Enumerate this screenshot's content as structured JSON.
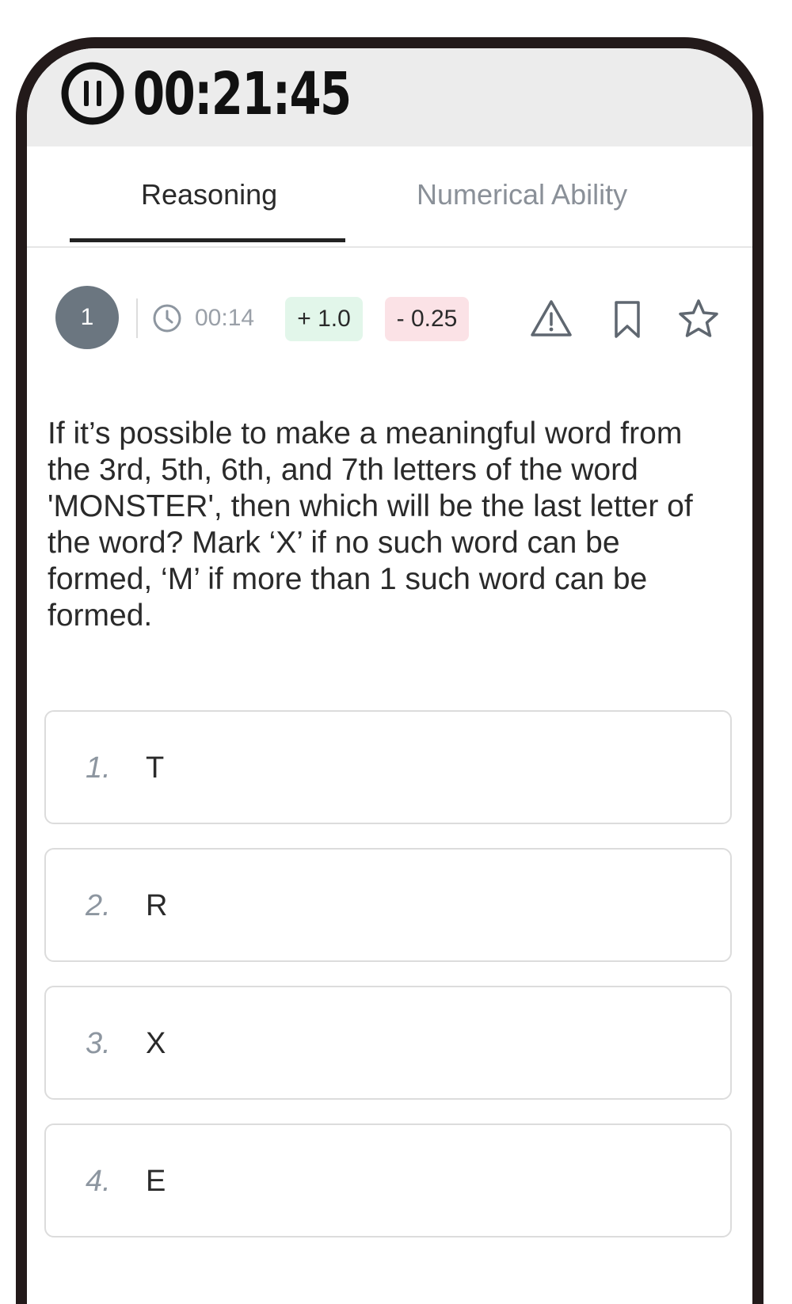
{
  "timer": {
    "value": "00:21:45",
    "icon": "pause-icon"
  },
  "tabs": [
    {
      "label": "Reasoning",
      "active": true
    },
    {
      "label": "Numerical Ability",
      "active": false
    }
  ],
  "question_bar": {
    "number": "1",
    "time": "00:14",
    "positive_marks": "+ 1.0",
    "negative_marks": "- 0.25",
    "icons": [
      "clock-icon",
      "warning-icon",
      "bookmark-icon",
      "star-icon"
    ]
  },
  "question": {
    "text": "If it’s possible to make a meaningful word from the 3rd, 5th, 6th, and 7th letters of the word 'MONSTER', then which will be the last letter of the word? Mark ‘X’ if no such word can be formed, ‘M’ if more than 1 such word can be formed."
  },
  "options": [
    {
      "num": "1.",
      "text": "T"
    },
    {
      "num": "2.",
      "text": "R"
    },
    {
      "num": "3.",
      "text": "X"
    },
    {
      "num": "4.",
      "text": "E"
    }
  ],
  "colors": {
    "frame": "#231a1a",
    "timer_bar": "#ececec",
    "badge_positive": "#e2f6ea",
    "badge_negative": "#fbe2e6",
    "question_circle": "#6b7680"
  }
}
